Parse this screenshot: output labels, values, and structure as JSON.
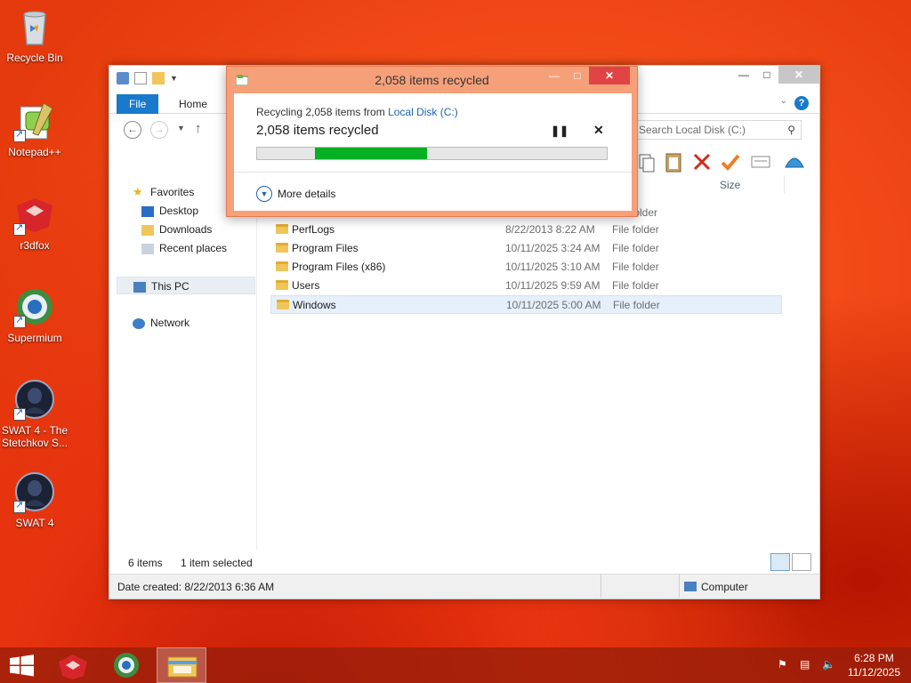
{
  "desktop": {
    "icons": [
      {
        "label": "Recycle Bin",
        "icon": "recycle-bin-icon"
      },
      {
        "label": "Notepad++",
        "icon": "notepad-plus-plus-icon"
      },
      {
        "label": "r3dfox",
        "icon": "r3dfox-icon"
      },
      {
        "label": "Supermium",
        "icon": "supermium-icon"
      },
      {
        "label": "SWAT 4 - The Stetchkov S...",
        "icon": "swat4-stetchkov-icon"
      },
      {
        "label": "SWAT 4",
        "icon": "swat4-icon"
      }
    ]
  },
  "explorer": {
    "tabs": {
      "file": "File",
      "home": "Home"
    },
    "search_placeholder": "Search Local Disk (C:)",
    "nav": {
      "favorites": "Favorites",
      "desktop": "Desktop",
      "downloads": "Downloads",
      "recent": "Recent places",
      "this_pc": "This PC",
      "network": "Network"
    },
    "columns": {
      "type_partial": "folder",
      "size": "Size"
    },
    "rows": [
      {
        "name": "PerfLogs",
        "date": "8/22/2013 8:22 AM",
        "type": "File folder"
      },
      {
        "name": "Program Files",
        "date": "10/11/2025 3:24 AM",
        "type": "File folder"
      },
      {
        "name": "Program Files (x86)",
        "date": "10/11/2025 3:10 AM",
        "type": "File folder"
      },
      {
        "name": "Users",
        "date": "10/11/2025 9:59 AM",
        "type": "File folder"
      },
      {
        "name": "Windows",
        "date": "10/11/2025 5:00 AM",
        "type": "File folder"
      }
    ],
    "status": {
      "items": "6 items",
      "selected": "1 item selected"
    },
    "details": {
      "date_created": "Date created: 8/22/2013 6:36 AM",
      "location": "Computer"
    }
  },
  "dialog": {
    "title": "2,058 items recycled",
    "line1_prefix": "Recycling 2,058 items from ",
    "line1_link": "Local Disk (C:)",
    "status": "2,058 items recycled",
    "progress_start": 0.165,
    "progress_end": 0.485,
    "more_details": "More details",
    "accent_color": "#06b025"
  },
  "taskbar": {
    "time": "6:28 PM",
    "date": "11/12/2025"
  },
  "colors": {
    "wallpaper": "#f24a17",
    "file_tab": "#1979ca",
    "dialog_frame": "#f6a079"
  }
}
